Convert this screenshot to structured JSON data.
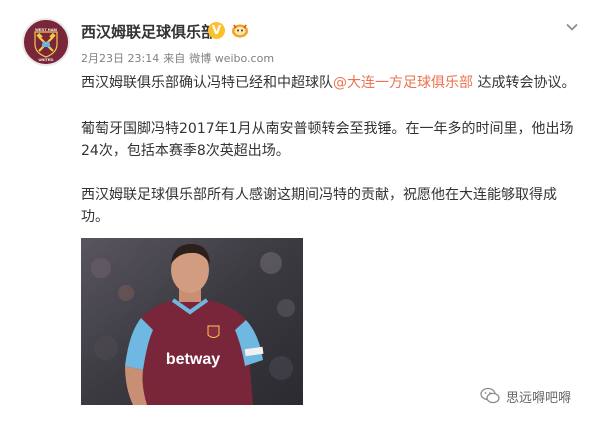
{
  "post": {
    "author": "西汉姆联足球俱乐部",
    "verified_mark": "V",
    "date": "2月23日 23:14",
    "source_prefix": "来自",
    "source": "微博 weibo.com",
    "p1_before": "西汉姆联俱乐部确认冯特已经和中超球队",
    "p1_mention": "@大连一方足球俱乐部",
    "p1_after": " 达成转会协议。",
    "p2": "葡萄牙国脚冯特2017年1月从南安普顿转会至我锤。在一年多的时间里，他出场24次，包括本赛季8次英超出场。",
    "p3": "西汉姆联足球俱乐部所有人感谢这期间冯特的贡献，祝愿他在大连能够取得成功。"
  },
  "crest": {
    "top_text": "WEST HAM",
    "bottom_text": "UNITED"
  },
  "photo": {
    "sponsor": "betway"
  },
  "watermark": {
    "text": "思远嘚吧嘚"
  },
  "colors": {
    "mention": "#eb7350",
    "claret": "#7a263a",
    "blue": "#5fb6e8",
    "verified": "#fcc02a"
  }
}
